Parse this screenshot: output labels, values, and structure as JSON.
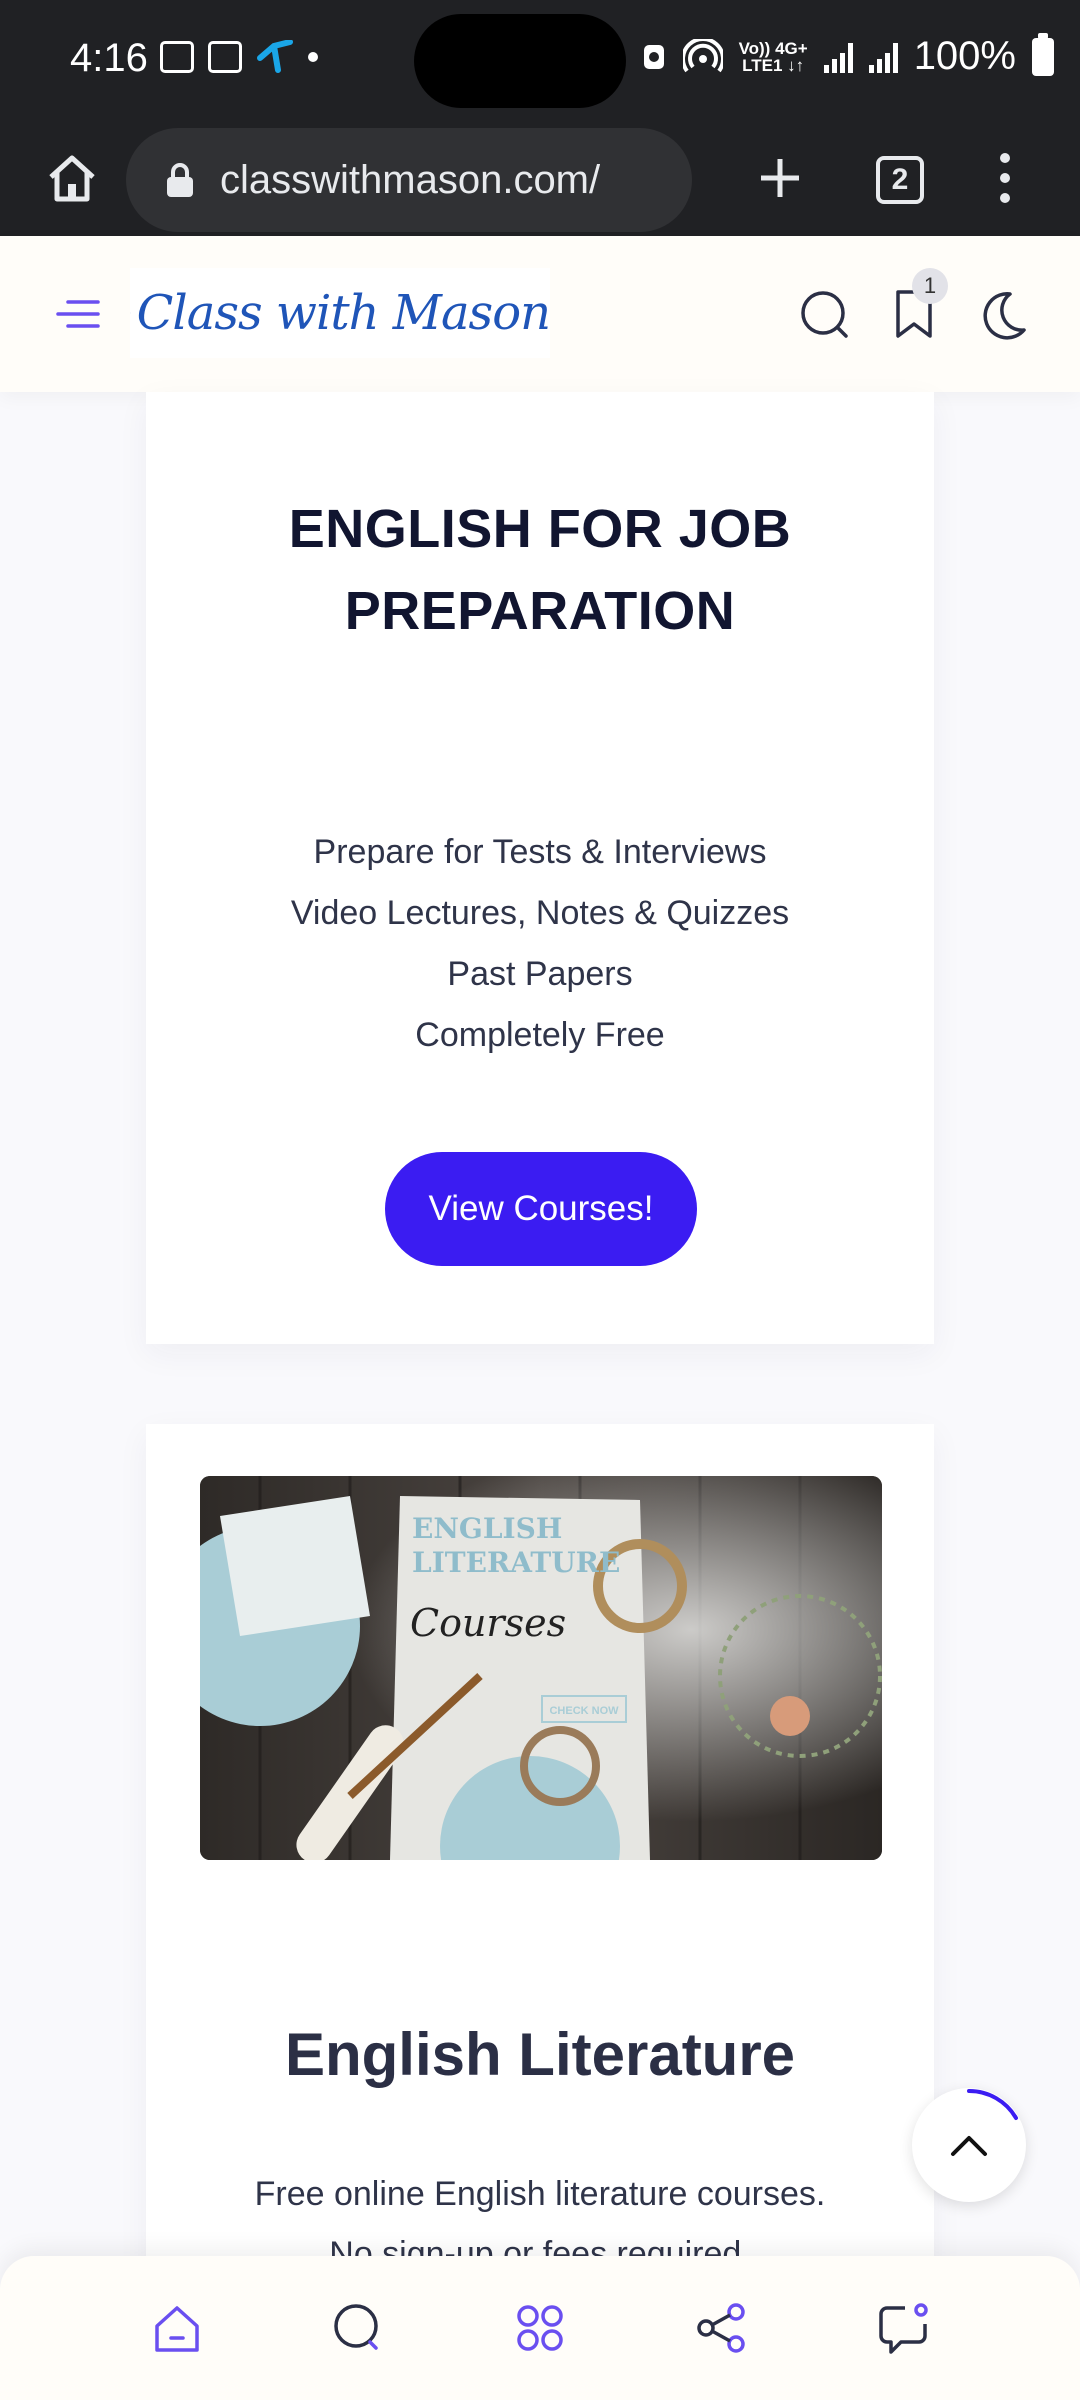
{
  "status_bar": {
    "time": "4:16",
    "network_label_top": "Vo)) 4G+",
    "network_label_bottom": "LTE1 ↓↑",
    "battery": "100%"
  },
  "browser": {
    "url": "classwithmason.com/",
    "tab_count": "2"
  },
  "site_header": {
    "logo_text": "Class with Mason",
    "bookmark_count": "1"
  },
  "card_job": {
    "title_line1": "ENGLISH FOR JOB",
    "title_line2": "PREPARATION",
    "features": [
      "Prepare for Tests & Interviews",
      "Video Lectures, Notes & Quizzes",
      "Past Papers",
      "Completely Free"
    ],
    "button_label": "View Courses!"
  },
  "card_literature": {
    "image_heading_line1": "ENGLISH",
    "image_heading_line2": "LITERATURE",
    "image_script": "Courses",
    "image_button": "CHECK NOW",
    "title": "English Literature",
    "desc_line1": "Free online English literature courses.",
    "desc_line2": "No sign-up or fees required."
  },
  "colors": {
    "accent": "#3b1cf2",
    "nav_icon": "#6a4ff0",
    "chrome_dark": "#202124"
  },
  "icons": {
    "bottom_nav": [
      "home-icon",
      "search-icon",
      "apps-icon",
      "share-icon",
      "chat-icon"
    ]
  }
}
